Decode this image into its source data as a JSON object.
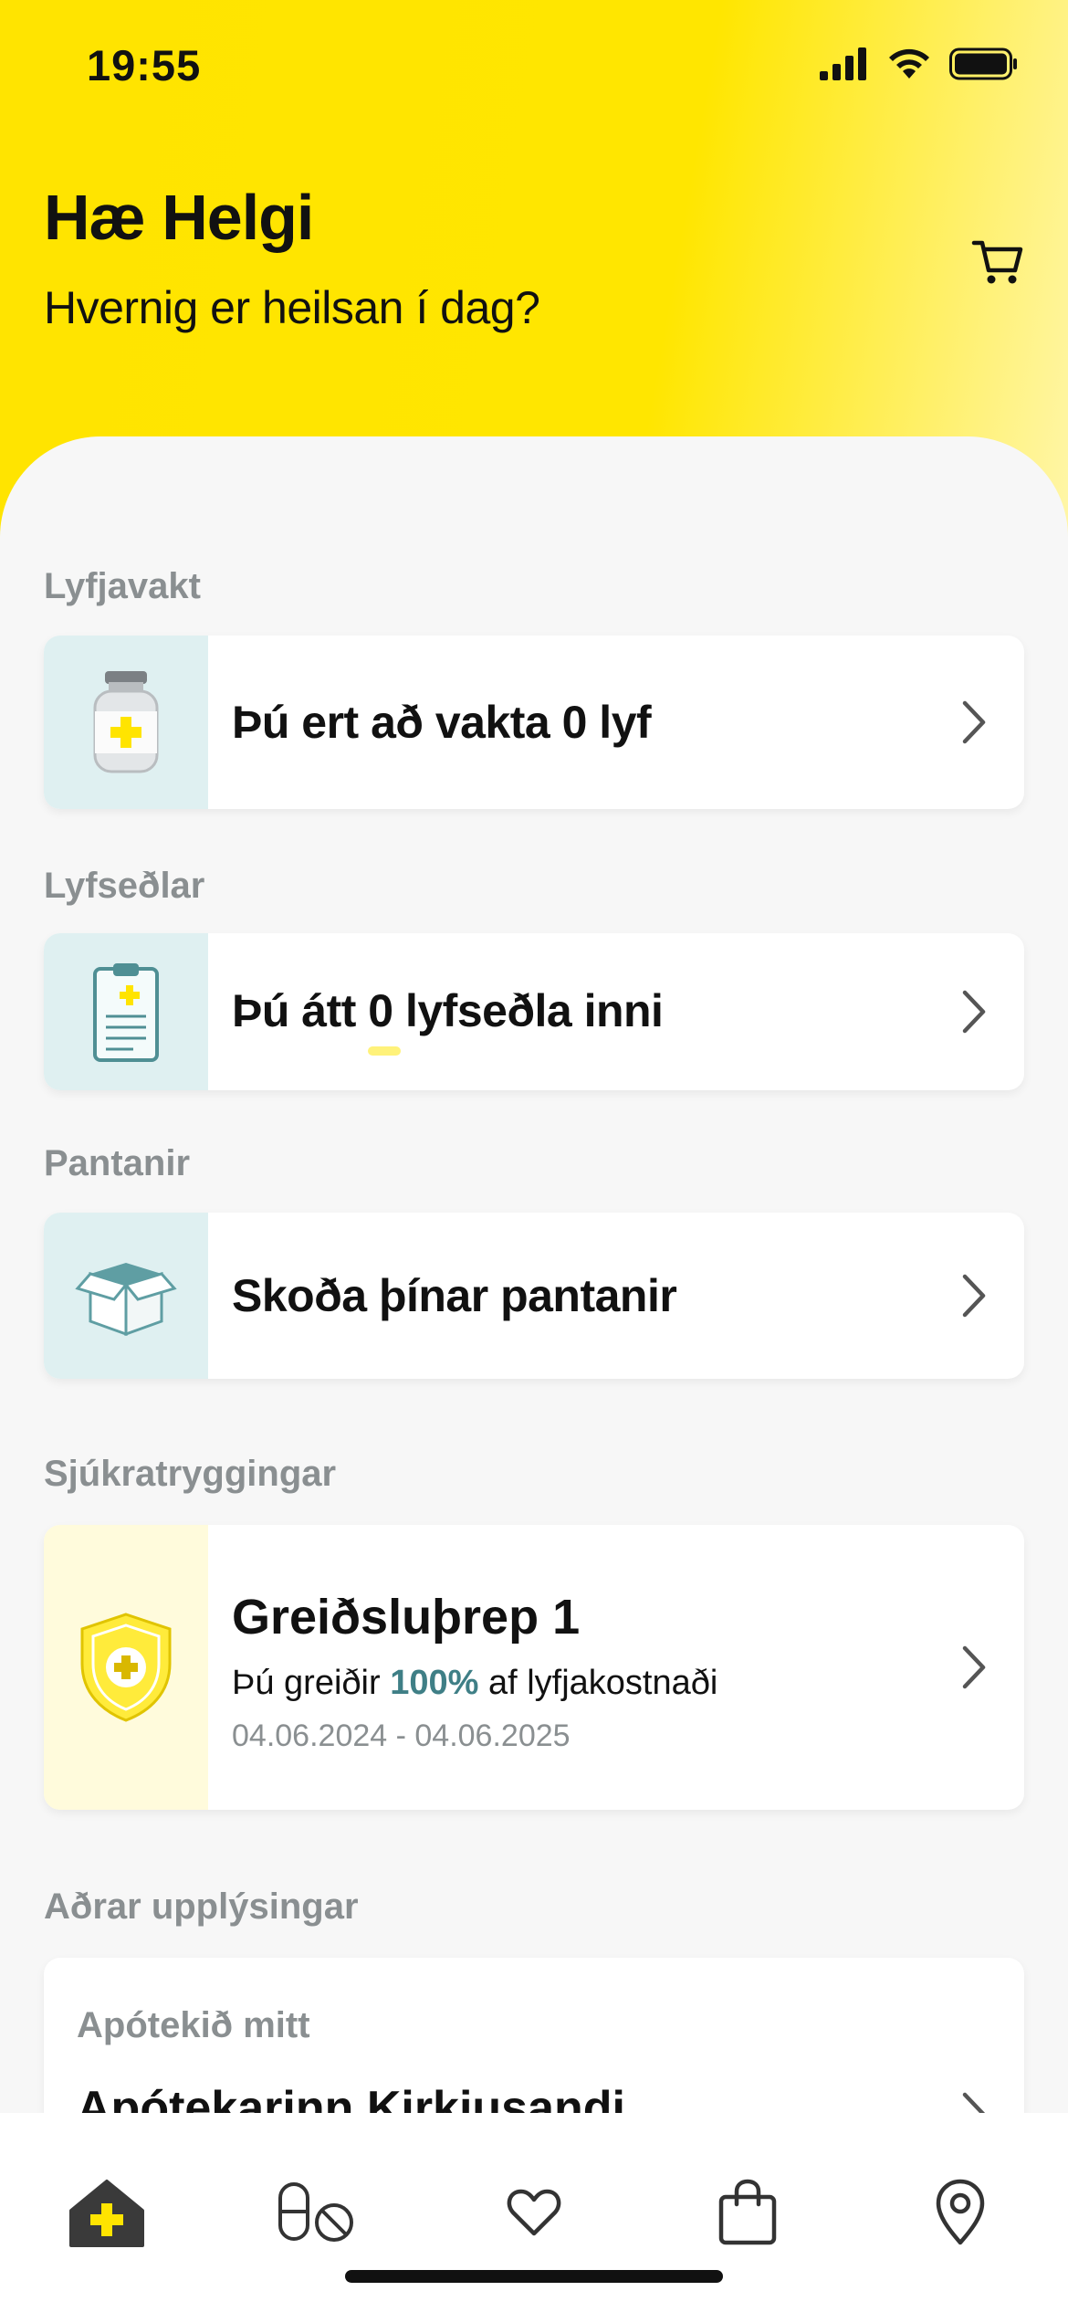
{
  "status": {
    "time": "19:55"
  },
  "header": {
    "greeting": "Hæ Helgi",
    "subtitle": "Hvernig er heilsan í dag?"
  },
  "sections": {
    "lyfjavakt": {
      "label": "Lyfjavakt",
      "title": "Þú ert að vakta 0 lyf"
    },
    "lyfsedlar": {
      "label": "Lyfseðlar",
      "title": "Þú átt 0 lyfseðla inni"
    },
    "pantanir": {
      "label": "Pantanir",
      "title": "Skoða þínar pantanir"
    },
    "sjukratryggingar": {
      "label": "Sjúkratryggingar",
      "title": "Greiðsluþrep 1",
      "line_prefix": "Þú greiðir",
      "percent": "100%",
      "line_suffix": "af lyfjakostnaði",
      "dates": "04.06.2024 - 04.06.2025"
    },
    "adrar": {
      "label": "Aðrar upplýsingar",
      "subtitle": "Apótekið mitt",
      "title": "Apótekarinn Kirkjusandi"
    }
  },
  "tabs": [
    "home-icon",
    "medication-icon",
    "heart-icon",
    "shopping-bag-icon",
    "map-pin-icon"
  ],
  "colors": {
    "brand_yellow": "#ffe600",
    "teal": "#3f7f86",
    "icon_bg": "#dff0f1"
  }
}
